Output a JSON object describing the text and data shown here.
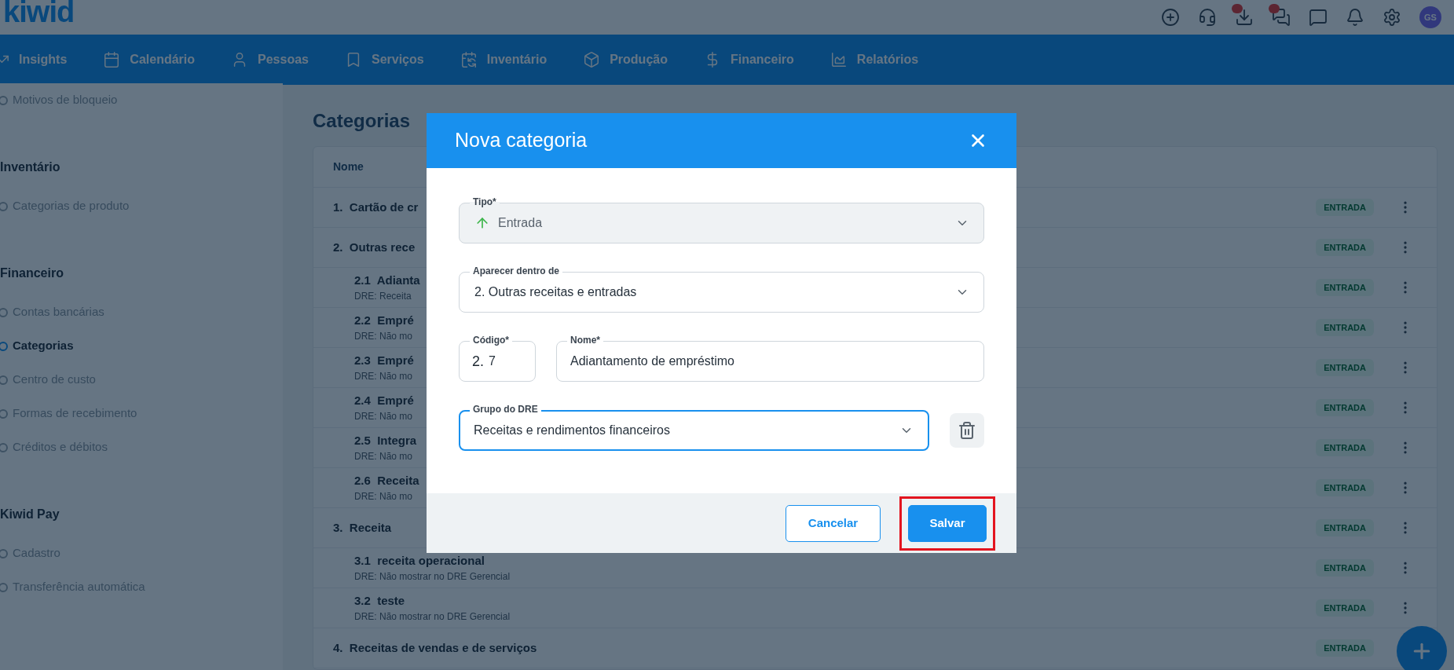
{
  "topbar": {
    "logo": "kiwid",
    "avatar": "GS",
    "icons": [
      {
        "kind": "add",
        "badge": false
      },
      {
        "kind": "support",
        "badge": false
      },
      {
        "kind": "download",
        "badge": true
      },
      {
        "kind": "chats",
        "badge": true
      },
      {
        "kind": "chat",
        "badge": false
      },
      {
        "kind": "bell",
        "badge": false
      },
      {
        "kind": "settings",
        "badge": false
      }
    ]
  },
  "nav": [
    {
      "label": "Insights"
    },
    {
      "label": "Calendário"
    },
    {
      "label": "Pessoas"
    },
    {
      "label": "Serviços"
    },
    {
      "label": "Inventário"
    },
    {
      "label": "Produção"
    },
    {
      "label": "Financeiro"
    },
    {
      "label": "Relatórios"
    }
  ],
  "sidebar": [
    {
      "kind": "item",
      "label": "Motivos de bloqueio",
      "selected": false
    },
    {
      "kind": "heading",
      "label": "Inventário"
    },
    {
      "kind": "item",
      "label": "Categorias de produto",
      "selected": false
    },
    {
      "kind": "heading",
      "label": "Financeiro"
    },
    {
      "kind": "item",
      "label": "Contas bancárias",
      "selected": false
    },
    {
      "kind": "item",
      "label": "Categorias",
      "selected": true
    },
    {
      "kind": "item",
      "label": "Centro de custo",
      "selected": false
    },
    {
      "kind": "item",
      "label": "Formas de recebimento",
      "selected": false
    },
    {
      "kind": "item",
      "label": "Créditos e débitos",
      "selected": false
    },
    {
      "kind": "heading",
      "label": "Kiwid Pay"
    },
    {
      "kind": "item",
      "label": "Cadastro",
      "selected": false
    },
    {
      "kind": "item",
      "label": "Transferência automática",
      "selected": false
    }
  ],
  "page": {
    "title": "Categorias",
    "column_1": "Nome",
    "rows": [
      {
        "kind": "group",
        "code": "1.",
        "name": "Cartão de cr",
        "badge": "ENTRADA",
        "menu": true
      },
      {
        "kind": "group",
        "code": "2.",
        "name": "Outras rece",
        "badge": "ENTRADA",
        "menu": true
      },
      {
        "kind": "sub",
        "code": "2.1",
        "name": "Adianta",
        "dre": "DRE: Receita",
        "badge": "ENTRADA",
        "menu": true
      },
      {
        "kind": "sub",
        "code": "2.2",
        "name": "Empré",
        "dre": "DRE: Não mo",
        "badge": "ENTRADA",
        "menu": true
      },
      {
        "kind": "sub",
        "code": "2.3",
        "name": "Empré",
        "dre": "DRE: Não mo",
        "badge": "ENTRADA",
        "menu": true
      },
      {
        "kind": "sub",
        "code": "2.4",
        "name": "Empré",
        "dre": "DRE: Não mo",
        "badge": "ENTRADA",
        "menu": true
      },
      {
        "kind": "sub",
        "code": "2.5",
        "name": "Integra",
        "dre": "DRE: Não mo",
        "badge": "ENTRADA",
        "menu": true
      },
      {
        "kind": "sub",
        "code": "2.6",
        "name": "Receita",
        "dre": "DRE: Não mo",
        "badge": "ENTRADA",
        "menu": true
      },
      {
        "kind": "group",
        "code": "3.",
        "name": "Receita",
        "badge": "ENTRADA",
        "menu": true
      },
      {
        "kind": "sub",
        "code": "3.1",
        "name": "receita operacional",
        "dre": "DRE: Não mostrar no DRE Gerencial",
        "badge": "ENTRADA",
        "menu": true
      },
      {
        "kind": "sub",
        "code": "3.2",
        "name": "teste",
        "dre": "DRE: Não mostrar no DRE Gerencial",
        "badge": "ENTRADA",
        "menu": true
      },
      {
        "kind": "group",
        "code": "4.",
        "name": "Receitas de vendas e de serviços",
        "badge": "ENTRADA"
      }
    ]
  },
  "dialog": {
    "title": "Nova categoria",
    "tipo": {
      "label": "Tipo*",
      "value": "Entrada",
      "disabled": true
    },
    "parent": {
      "label": "Aparecer dentro de",
      "value": "2. Outras receitas e entradas"
    },
    "code": {
      "label": "Código*",
      "prefix": "2.",
      "value": "7"
    },
    "name": {
      "label": "Nome*",
      "value": "Adiantamento de empréstimo"
    },
    "dre": {
      "label": "Grupo do DRE",
      "value": "Receitas e rendimentos financeiros",
      "focused": true
    },
    "buttons": [
      {
        "kind": "secondary",
        "label": "Cancelar",
        "highlighted": false
      },
      {
        "kind": "primary",
        "label": "Salvar",
        "highlighted": true
      }
    ]
  }
}
